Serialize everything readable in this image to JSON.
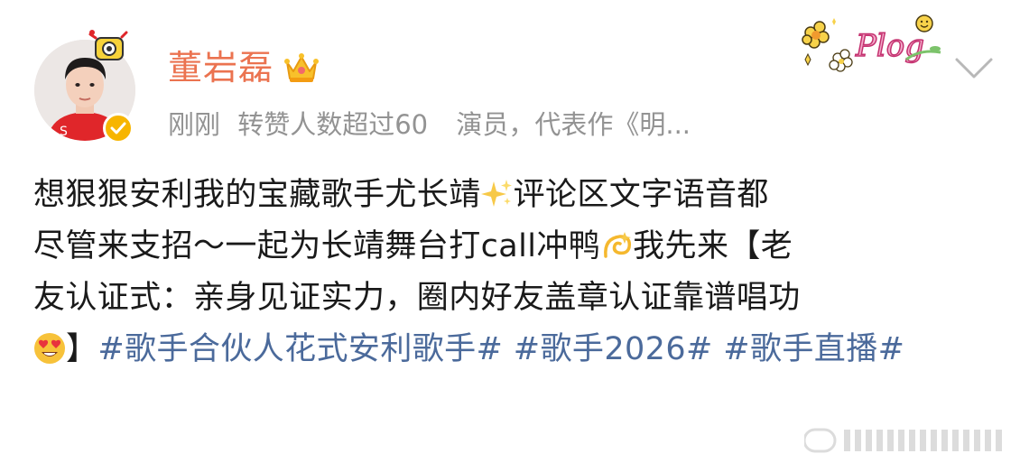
{
  "post": {
    "username": "董岩磊",
    "time": "刚刚",
    "forward_note": "转赞人数超过60",
    "bio": "演员，代表作《明...",
    "content": {
      "line1": "想狠狠安利我的宝藏歌手尤长靖",
      "line1b": "评论区文字语音都",
      "line2": "尽管来支招～一起为长靖舞台打call冲鸭",
      "line2b": "我先来【老",
      "line3": "友认证式：亲身见证实力，圈内好友盖章认证靠谱唱功",
      "line4_close": "】",
      "tags": [
        "#歌手合伙人花式安利歌手#",
        "#歌手2026#",
        "#歌手直播#"
      ]
    },
    "icons": {
      "sparkles": "sparkles-emoji",
      "dizzy": "dizzy-emoji",
      "heart_eyes": "heart-eyes-emoji",
      "crown": "crown-icon",
      "verified": "verified-badge-icon",
      "more": "chevron-down-icon",
      "decoration": "plog-decoration"
    },
    "colors": {
      "username": "#eb7350",
      "meta": "#939393",
      "text": "#1a1a1a",
      "hashtag": "#4b6a9b",
      "verified": "#f7b500"
    }
  }
}
